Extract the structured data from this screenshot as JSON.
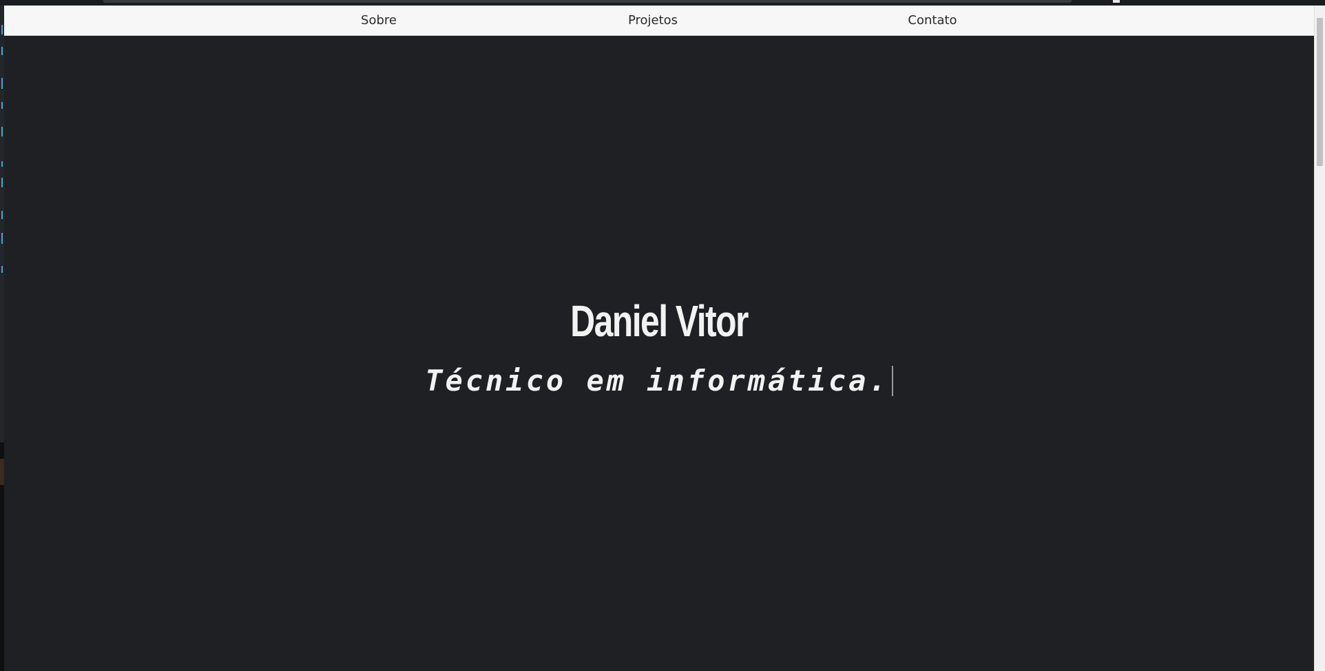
{
  "nav": {
    "items": [
      {
        "label": "Sobre"
      },
      {
        "label": "Projetos"
      },
      {
        "label": "Contato"
      }
    ]
  },
  "hero": {
    "title": "Daniel Vitor",
    "subtitle": "Técnico em informática."
  },
  "colors": {
    "page_background": "#1f2024",
    "navbar_background": "#f7f7f7",
    "text_light": "#f2f2f2",
    "nav_text": "#2b2b2b"
  },
  "icons": {
    "caret": "text-caret-icon"
  }
}
